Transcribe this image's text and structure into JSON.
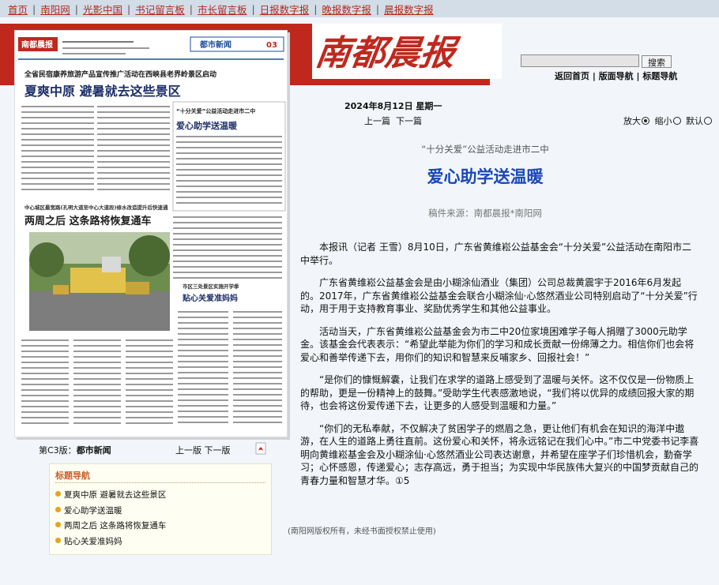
{
  "topnav": {
    "items": [
      "首页",
      "南阳网",
      "光影中国",
      "书记留言板",
      "市长留言板",
      "日报数字报",
      "晚报数字报",
      "晨报数字报"
    ]
  },
  "brand": {
    "logo_text": "南都晨报",
    "logo_color": "#c0281e"
  },
  "search": {
    "value": "",
    "button": "搜索"
  },
  "quicklinks": [
    "返回首页",
    "版面导航",
    "标题导航"
  ],
  "paper": {
    "masthead_name": "南都晨报",
    "section_tag": "都市新闻",
    "page_num": "03",
    "top_banner": "全省民宿康养旅游产品宣传推广活动在西峡县老界岭景区启动",
    "lead_headline": "夏爽中原 避暑就去这些景区",
    "side_kicker": "“十分关爱”公益活动走进市二中",
    "side_headline": "爱心助学送温暖",
    "mid_kicker": "中心城区最宽路(孔明大道至中心大道段)修水改造提升后快速通",
    "mid_headline": "两周之后 这条路将恢复通车",
    "small_kicker": "市区三处景区实施开学季",
    "small_headline": "贴心关爱准妈妈"
  },
  "page_label": {
    "prefix": "第C3版：",
    "name": "都市新闻"
  },
  "page_pager": {
    "prev": "上一版",
    "next": "下一版"
  },
  "title_nav": {
    "heading": "标题导航",
    "items": [
      "夏爽中原 避暑就去这些景区",
      "爱心助学送温暖",
      "两周之后 这条路将恢复通车",
      "贴心关爱准妈妈"
    ]
  },
  "issue_date": "2024年8月12日 星期一",
  "article_pager": {
    "prev": "上一篇",
    "next": "下一篇"
  },
  "zoom": {
    "bigger": "放大",
    "smaller": "缩小",
    "default": "默认"
  },
  "article": {
    "kicker": "“十分关爱”公益活动走进市二中",
    "headline": "爱心助学送温暖",
    "source": "稿件来源：南都晨报*南阳网",
    "paragraphs": [
      "本报讯（记者 王雪）8月10日，广东省黄维崧公益基金会“十分关爱”公益活动在南阳市二中举行。",
      "广东省黄维崧公益基金会是由小糊涂仙酒业（集团）公司总裁黄震宇于2016年6月发起的。2017年，广东省黄维崧公益基金会联合小糊涂仙·心悠然酒业公司特别启动了“十分关爱”行动，用于用于支持教育事业、奖励优秀学生和其他公益事业。",
      "活动当天，广东省黄维崧公益基金会为市二中20位家境困难学子每人捐赠了3000元助学金。该基金会代表表示：“希望此举能为你们的学习和成长贡献一份绵薄之力。相信你们也会将爱心和善举传递下去，用你们的知识和智慧来反哺家乡、回报社会！”",
      "“是你们的慷慨解囊，让我们在求学的道路上感受到了温暖与关怀。这不仅仅是一份物质上的帮助，更是一份精神上的鼓舞。”受助学生代表感激地说，“我们将以优异的成绩回报大家的期待，也会将这份爱传递下去，让更多的人感受到温暖和力量。”",
      "“你们的无私奉献，不仅解决了贫困学子的燃眉之急，更让他们有机会在知识的海洋中遨游，在人生的道路上勇往直前。这份爱心和关怀，将永远铭记在我们心中。”市二中党委书记李喜明向黄维崧基金会及小糊涂仙·心悠然酒业公司表达谢意，并希望在座学子们珍惜机会，勤奋学习；心怀感恩，传递爱心；志存高远，勇于担当；为实现中华民族伟大复兴的中国梦贡献自己的青春力量和智慧才华。①5"
    ]
  },
  "copyright": "(南阳网版权所有，未经书面授权禁止使用)"
}
